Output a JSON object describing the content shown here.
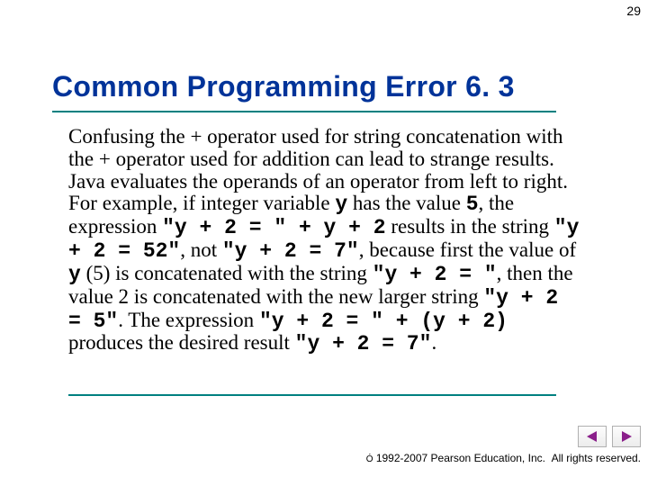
{
  "page_number": "29",
  "title": "Common Programming Error 6. 3",
  "body": {
    "t1": "Confusing the + operator used for string concatenation with the + operator used for addition can lead to strange results. Java evaluates the operands of an operator from left to right. For example, if integer variable ",
    "c1": "y",
    "t2": " has the value ",
    "c2": "5",
    "t3": ", the expression ",
    "c3": "\"y + 2 = \" + y + 2",
    "t4": " results in the string ",
    "c4": "\"y + 2 = 52\"",
    "t5": ", not ",
    "c5": "\"y + 2 = 7\"",
    "t6": ", because first the value of ",
    "c6": "y",
    "t7": " (5) is concatenated with the string ",
    "c7": "\"y + 2 = \"",
    "t8": ", then the value 2 is concatenated with the new larger string ",
    "c8": "\"y + 2 = 5\"",
    "t9": ". The expression ",
    "c9": "\"y + 2 = \" + (y + 2)",
    "t10": " produces the desired result ",
    "c10": "\"y + 2 = 7\"",
    "t11": "."
  },
  "footer": {
    "copyright_symbol": "Ó",
    "years": "1992-2007 Pearson Education, Inc.",
    "rights": "All rights reserved."
  },
  "nav": {
    "prev": "previous-slide",
    "next": "next-slide"
  },
  "colors": {
    "title": "#003399",
    "rule": "#008080",
    "nav_arrow": "#8a1f8a"
  }
}
